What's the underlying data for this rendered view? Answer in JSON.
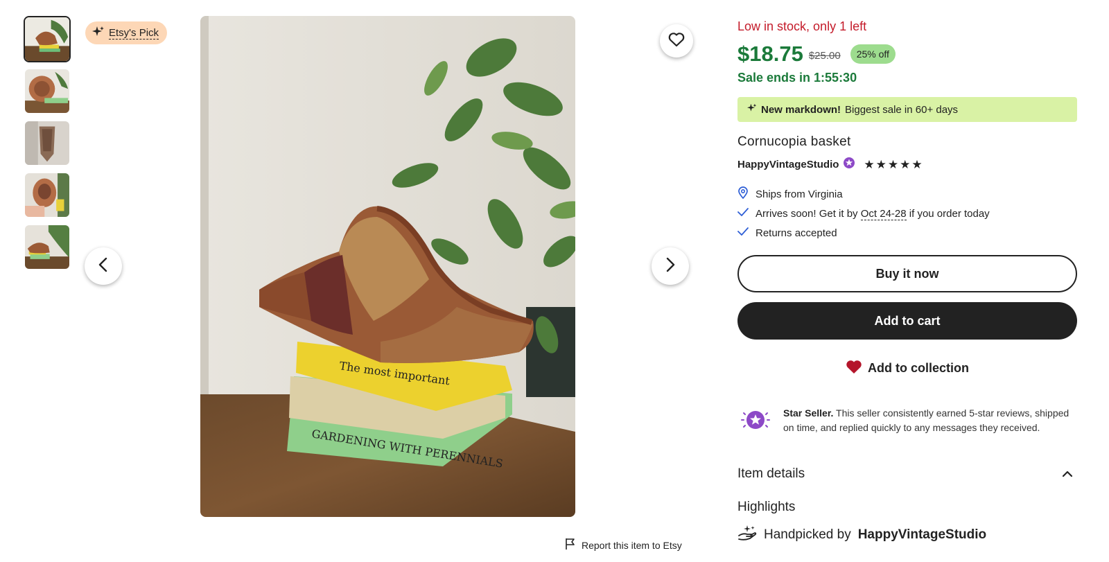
{
  "badge": {
    "label": "Etsy's Pick"
  },
  "stock_text": "Low in stock, only 1 left",
  "price": {
    "current": "$18.75",
    "original": "$25.00",
    "discount": "25% off",
    "sale_ends": "Sale ends in 1:55:30"
  },
  "markdown": {
    "bold": "New markdown!",
    "text": "Biggest sale in 60+ days"
  },
  "listing_title": "Cornucopia basket",
  "shop": {
    "name": "HappyVintageStudio",
    "rating_stars": 5
  },
  "shipping": {
    "ships_from": "Ships from Virginia",
    "arrives_prefix": "Arrives soon! Get it by",
    "arrives_dates": "Oct 24-28",
    "arrives_suffix": "if you order today",
    "returns": "Returns accepted"
  },
  "buttons": {
    "buy_now": "Buy it now",
    "add_to_cart": "Add to cart",
    "add_to_collection": "Add to collection"
  },
  "star_seller": {
    "title": "Star Seller.",
    "text": "This seller consistently earned 5-star reviews, shipped on time, and replied quickly to any messages they received."
  },
  "item_details": "Item details",
  "highlights": {
    "heading": "Highlights",
    "handpicked_prefix": "Handpicked by",
    "handpicked_shop": "HappyVintageStudio"
  },
  "report": "Report this item to Etsy",
  "thumbnails_count": 5,
  "colors": {
    "price_green": "#1b7a3a",
    "stock_red": "#c41b2a",
    "markdown_bg": "#d9f2a5",
    "discount_bg": "#9ddc8e",
    "pick_bg": "#fdd7b6",
    "primary_dark": "#222222",
    "heart_red": "#b4152b",
    "star_seller_purple": "#8d49c7",
    "check_blue": "#2f5fd6"
  }
}
